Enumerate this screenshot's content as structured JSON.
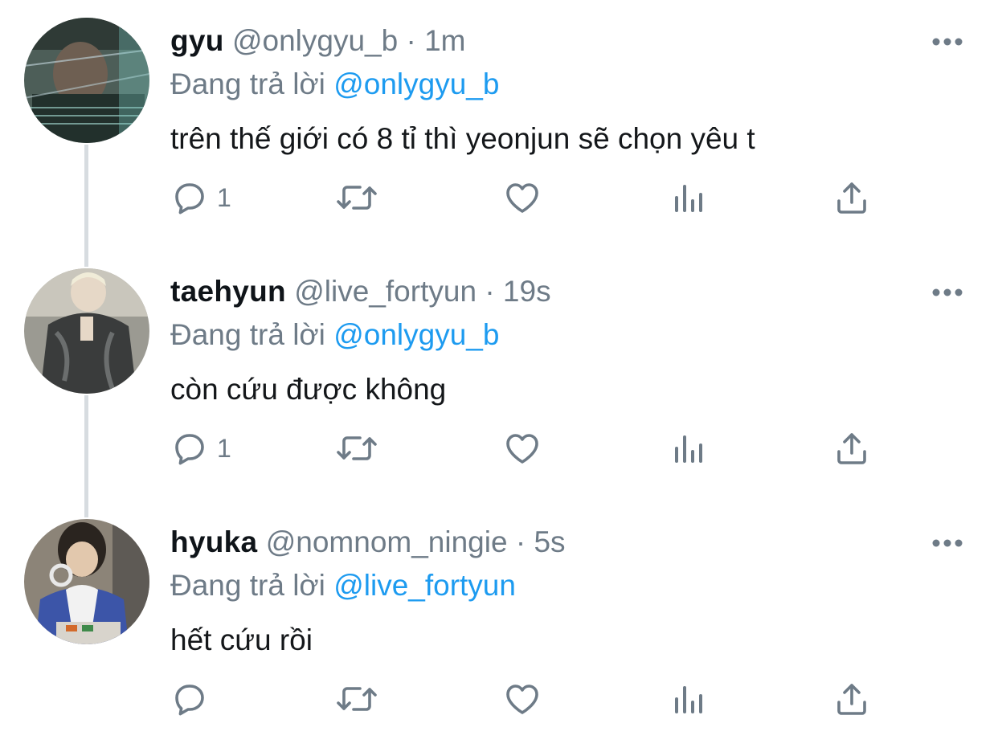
{
  "thread": {
    "tweets": [
      {
        "name": "gyu",
        "handle": "@onlygyu_b",
        "separator": "·",
        "time": "1m",
        "reply_prefix": "Đang trả lời",
        "reply_to": "@onlygyu_b",
        "text": "trên thế giới có 8 tỉ thì yeonjun sẽ chọn yêu t",
        "reply_count": "1",
        "avatar": "avatar-gyu"
      },
      {
        "name": "taehyun",
        "handle": "@live_fortyun",
        "separator": "·",
        "time": "19s",
        "reply_prefix": "Đang trả lời",
        "reply_to": "@onlygyu_b",
        "text": "còn cứu được không",
        "reply_count": "1",
        "avatar": "avatar-taehyun"
      },
      {
        "name": "hyuka",
        "handle": "@nomnom_ningie",
        "separator": "·",
        "time": "5s",
        "reply_prefix": "Đang trả lời",
        "reply_to": "@live_fortyun",
        "text": "hết cứu rồi",
        "reply_count": "",
        "avatar": "avatar-hyuka"
      }
    ]
  },
  "icons": {
    "reply": "reply-icon",
    "retweet": "retweet-icon",
    "like": "heart-icon",
    "views": "analytics-icon",
    "share": "share-icon",
    "more": "more-icon"
  },
  "colors": {
    "link": "#1d9bf0",
    "secondary_text": "#6e7b87",
    "primary_text": "#0f1419",
    "thread_line": "#d7dce0"
  }
}
